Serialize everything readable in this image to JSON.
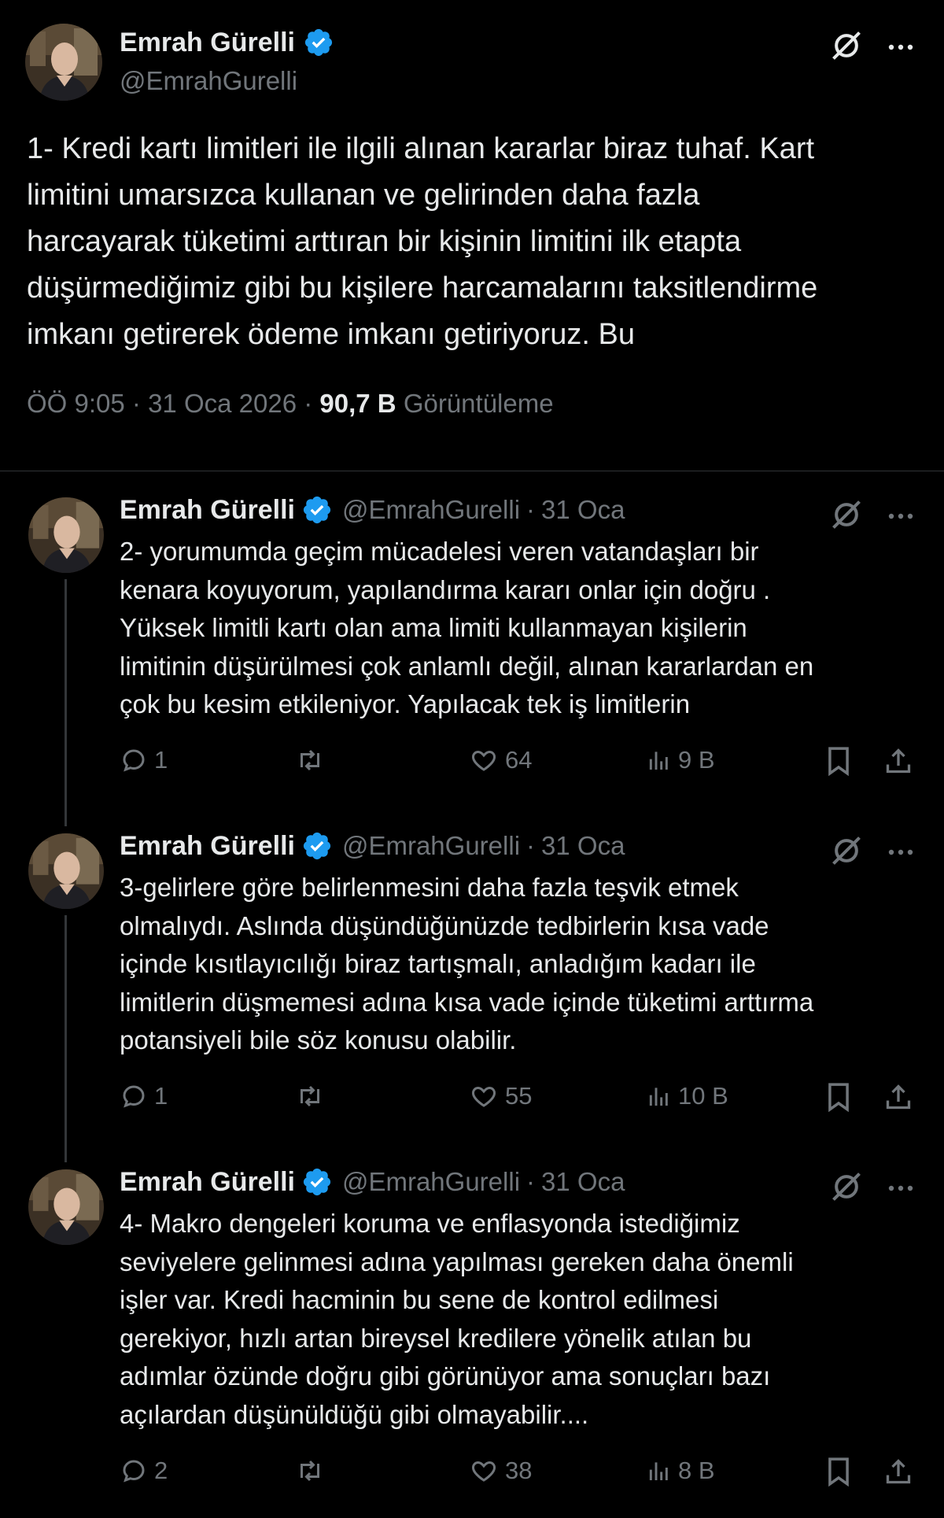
{
  "main_tweet": {
    "author_name": "Emrah Gürelli",
    "author_handle": "@EmrahGurelli",
    "text_lines": [
      "1- Kredi kartı limitleri ile ilgili alınan kararlar biraz tuhaf. Kart",
      "limitini umarsızca kullanan ve gelirinden daha fazla",
      "harcayarak tüketimi arttıran bir kişinin limitini ilk etapta",
      "düşürmediğimiz gibi bu kişilere harcamalarını taksitlendirme",
      "imkanı getirerek ödeme imkanı getiriyoruz. Bu"
    ],
    "time": "ÖÖ 9:05",
    "date": "31 Oca 2026",
    "views_count": "90,7 B",
    "views_label": "Görüntüleme",
    "separator": "·"
  },
  "replies": [
    {
      "author_name": "Emrah Gürelli",
      "author_handle": "@EmrahGurelli",
      "date": "31 Oca",
      "text_lines": [
        "2- yorumumda geçim mücadelesi veren vatandaşları bir",
        "kenara koyuyorum, yapılandırma kararı onlar için doğru .",
        "Yüksek limitli kartı olan ama limiti kullanmayan kişilerin",
        "limitinin düşürülmesi çok anlamlı değil, alınan kararlardan en",
        "çok bu kesim etkileniyor. Yapılacak tek iş limitlerin"
      ],
      "replies": "1",
      "likes": "64",
      "views": "9 B"
    },
    {
      "author_name": "Emrah Gürelli",
      "author_handle": "@EmrahGurelli",
      "date": "31 Oca",
      "text_lines": [
        "3-gelirlere göre belirlenmesini daha fazla teşvik etmek",
        "olmalıydı. Aslında düşündüğünüzde tedbirlerin kısa vade",
        "içinde kısıtlayıcılığı biraz tartışmalı, anladığım kadarı ile",
        "limitlerin düşmemesi adına kısa vade içinde tüketimi arttırma",
        "potansiyeli bile söz konusu olabilir."
      ],
      "replies": "1",
      "likes": "55",
      "views": "10 B"
    },
    {
      "author_name": "Emrah Gürelli",
      "author_handle": "@EmrahGurelli",
      "date": "31 Oca",
      "text_lines": [
        "4- Makro dengeleri koruma ve enflasyonda istediğimiz",
        "seviyelere gelinmesi adına yapılması gereken daha önemli",
        "işler var. Kredi hacminin bu sene de kontrol edilmesi",
        "gerekiyor, hızlı artan bireysel kredilere yönelik atılan bu",
        "adımlar özünde doğru gibi görünüyor ama sonuçları bazı",
        "açılardan düşünüldüğü gibi olmayabilir...."
      ],
      "replies": "2",
      "likes": "38",
      "views": "8 B"
    }
  ],
  "colors": {
    "background": "#000000",
    "text": "#e7e9ea",
    "muted": "#71767b",
    "verified": "#1d9bf0",
    "divider": "#2f3336"
  },
  "icons": {
    "verified": "verified-badge-icon",
    "grok": "grok-icon",
    "more": "more-icon",
    "reply": "reply-icon",
    "retweet": "retweet-icon",
    "like": "like-icon",
    "views": "views-icon",
    "bookmark": "bookmark-icon",
    "share": "share-icon"
  }
}
